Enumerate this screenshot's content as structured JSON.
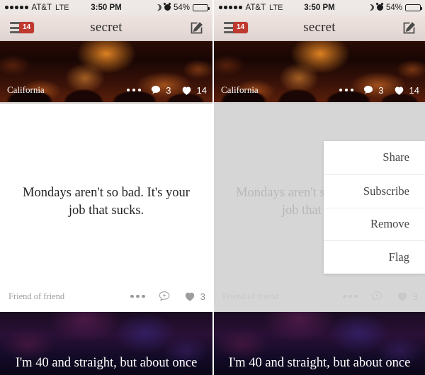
{
  "status_bar": {
    "signal_dots": 5,
    "carrier": "AT&T",
    "network": "LTE",
    "time": "3:50 PM",
    "moon_icon": "moon-icon",
    "alarm_icon": "alarm-clock-icon",
    "battery_percent": "54%",
    "battery_fill_ratio": 0.54
  },
  "nav_bar": {
    "menu_icon": "hamburger-menu-icon",
    "notification_badge": "14",
    "title": "secret",
    "compose_icon": "compose-pencil-icon"
  },
  "cards": {
    "image_card": {
      "location": "California",
      "more_icon": "ellipsis-icon",
      "comment_icon": "comment-bubble-icon",
      "comment_count": "3",
      "like_icon": "heart-icon",
      "like_count": "14"
    },
    "text_card": {
      "secret_text": "Mondays aren't so bad. It's your job that sucks.",
      "relation": "Friend of friend",
      "more_icon": "ellipsis-icon",
      "comment_icon": "comment-add-icon",
      "like_icon": "heart-icon",
      "like_count": "3"
    },
    "bottom_card": {
      "secret_text": "I'm 40 and straight, but about once"
    }
  },
  "popup_menu": {
    "items": [
      {
        "label": "Share"
      },
      {
        "label": "Subscribe"
      },
      {
        "label": "Remove"
      },
      {
        "label": "Flag"
      }
    ]
  },
  "colors": {
    "badge_red": "#c0392f",
    "navbar_top": "#eee3df",
    "navbar_bottom": "#ded3d1",
    "dim_overlay": "#cfcfcf",
    "text_primary": "#232323",
    "text_muted": "#9d9d9d"
  }
}
